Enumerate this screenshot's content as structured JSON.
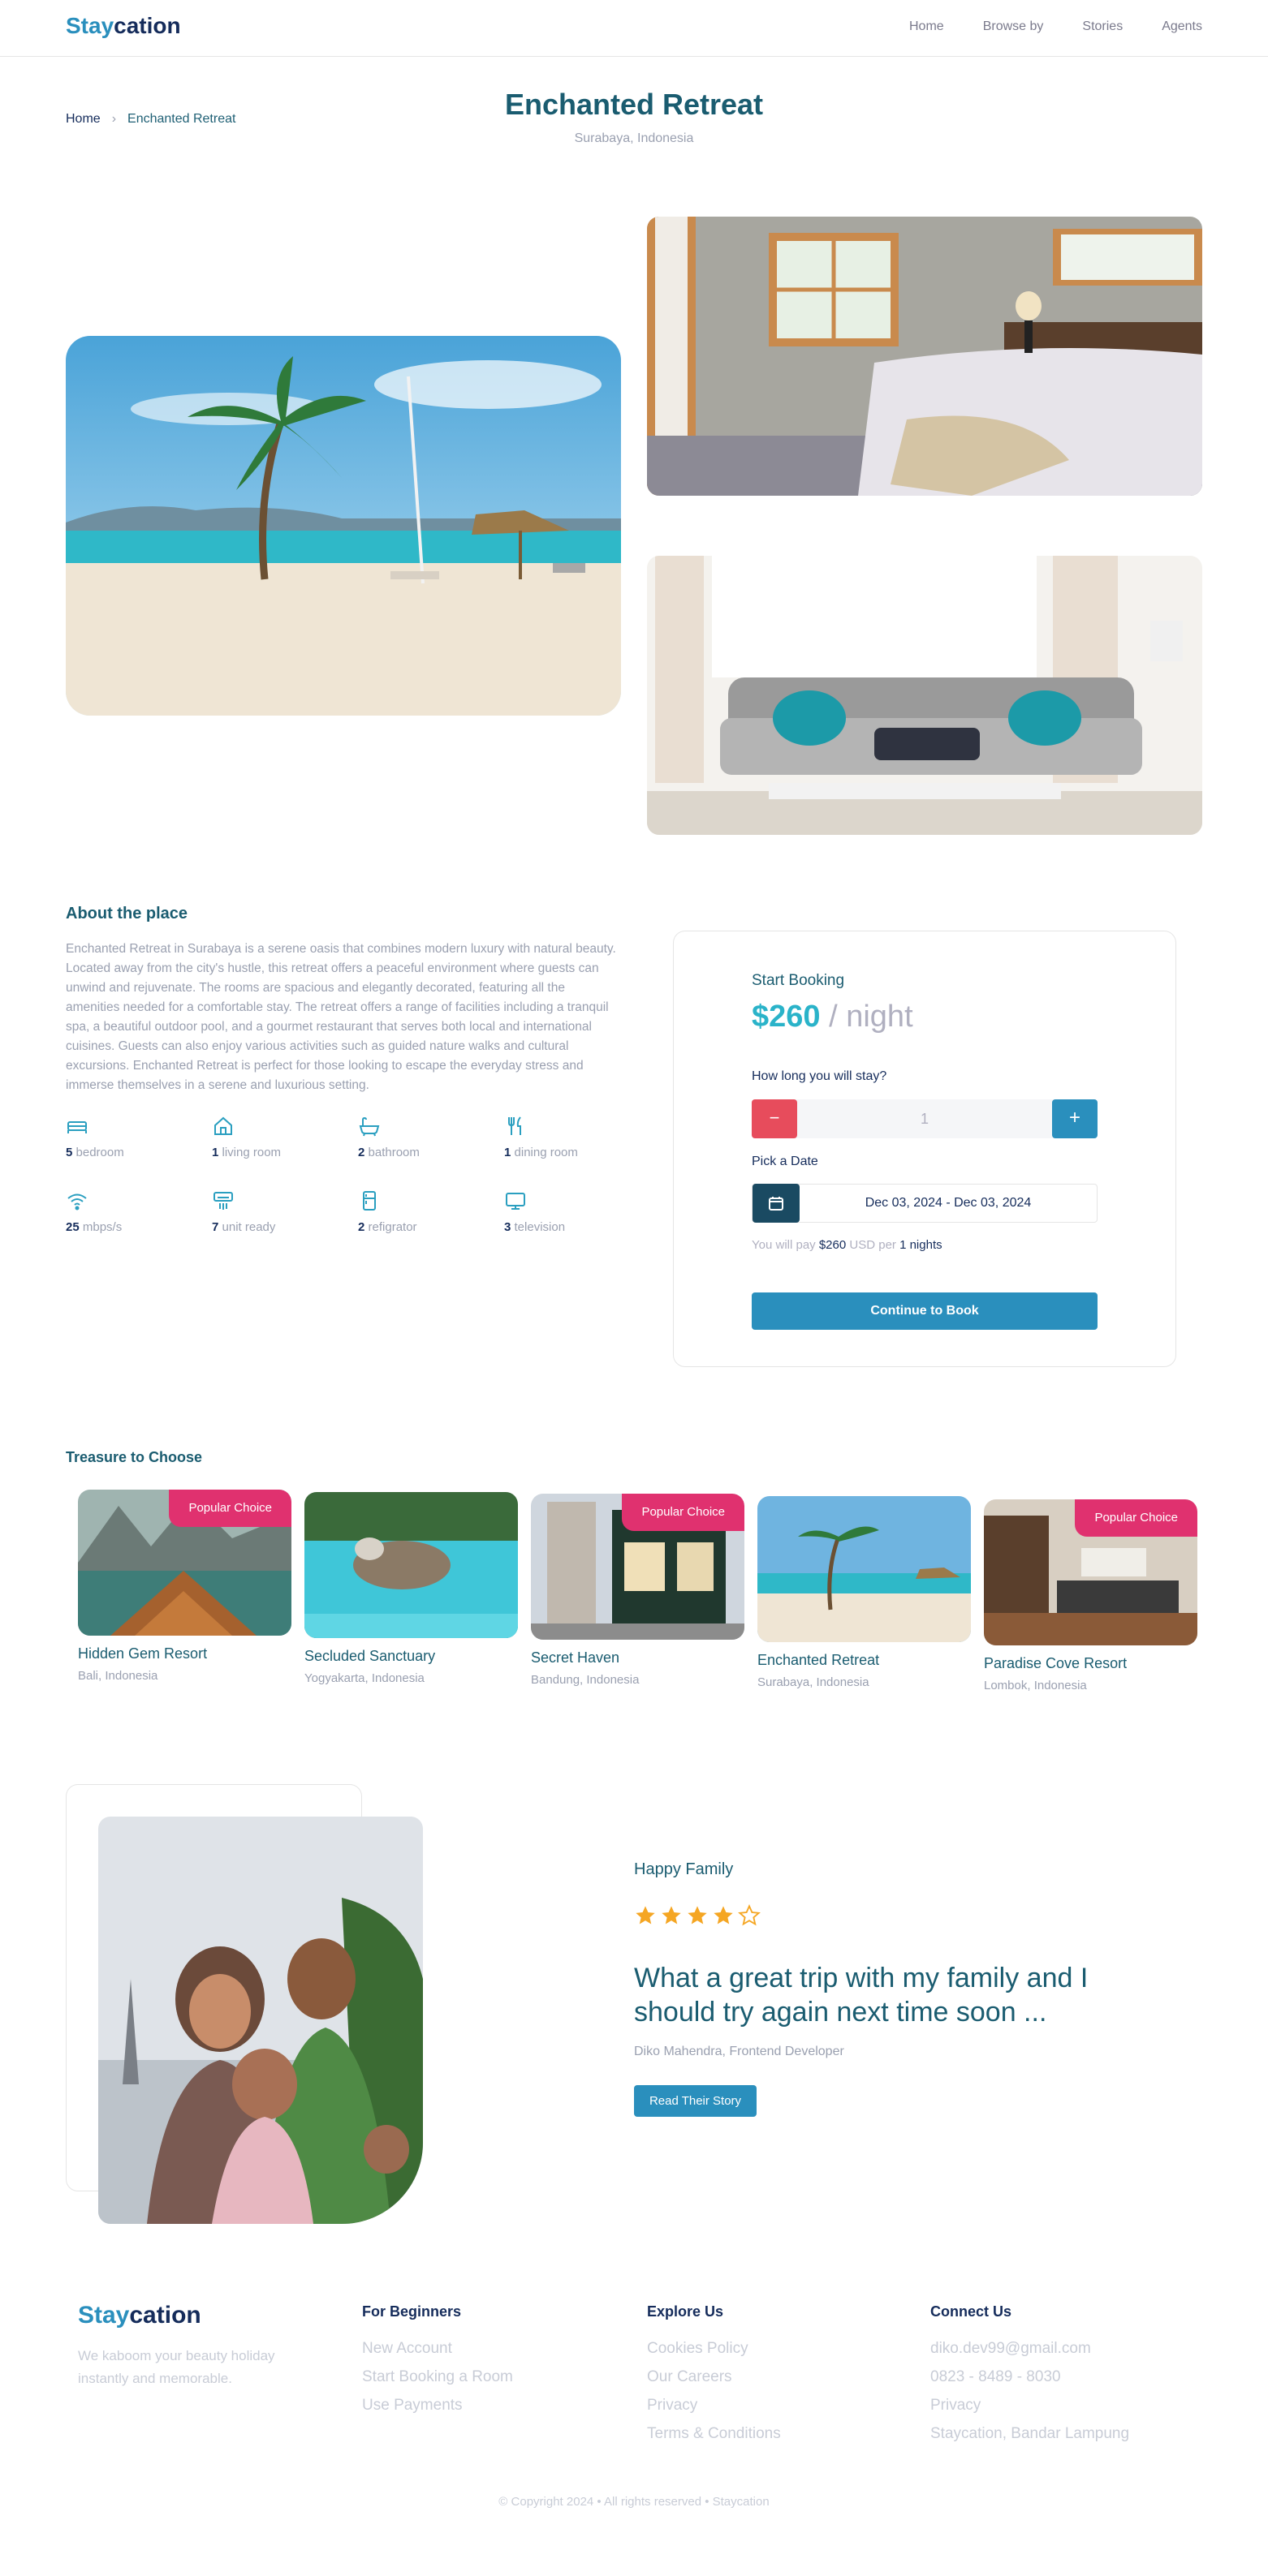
{
  "header": {
    "logo_accent": "Stay",
    "logo_rest": "cation",
    "nav": [
      "Home",
      "Browse by",
      "Stories",
      "Agents"
    ]
  },
  "breadcrumb": {
    "home": "Home",
    "separator": "›",
    "current": "Enchanted Retreat"
  },
  "title": "Enchanted Retreat",
  "subtitle": "Surabaya, Indonesia",
  "about": {
    "title": "About the place",
    "text": "Enchanted Retreat in Surabaya is a serene oasis that combines modern luxury with natural beauty. Located away from the city's hustle, this retreat offers a peaceful environment where guests can unwind and rejuvenate. The rooms are spacious and elegantly decorated, featuring all the amenities needed for a comfortable stay. The retreat offers a range of facilities including a tranquil spa, a beautiful outdoor pool, and a gourmet restaurant that serves both local and international cuisines. Guests can also enjoy various activities such as guided nature walks and cultural excursions. Enchanted Retreat is perfect for those looking to escape the everyday stress and immerse themselves in a serene and luxurious setting.",
    "features": [
      {
        "num": "5",
        "label": "bedroom",
        "icon": "bed-icon"
      },
      {
        "num": "1",
        "label": "living room",
        "icon": "house-icon"
      },
      {
        "num": "2",
        "label": "bathroom",
        "icon": "bathtub-icon"
      },
      {
        "num": "1",
        "label": "dining room",
        "icon": "cutlery-icon"
      },
      {
        "num": "25",
        "label": "mbps/s",
        "icon": "wifi-icon"
      },
      {
        "num": "7",
        "label": "unit ready",
        "icon": "ac-unit-icon"
      },
      {
        "num": "2",
        "label": "refigrator",
        "icon": "refrigerator-icon"
      },
      {
        "num": "3",
        "label": "television",
        "icon": "television-icon"
      }
    ]
  },
  "booking": {
    "title": "Start Booking",
    "price": "$260",
    "per": " / night",
    "stay_question": "How long you will stay?",
    "minus": "−",
    "nights_value": "1",
    "plus": "+",
    "date_label": "Pick a Date",
    "date_value": "Dec 03, 2024 - Dec 03, 2024",
    "pay_prefix": "You will pay ",
    "pay_amount": "$260",
    "pay_mid": " USD per ",
    "pay_nights": "1 nights",
    "button": "Continue to Book"
  },
  "treasure": {
    "title": "Treasure to Choose",
    "items": [
      {
        "name": "Hidden Gem Resort",
        "location": "Bali, Indonesia",
        "badge": "Popular Choice"
      },
      {
        "name": "Secluded Sanctuary",
        "location": "Yogyakarta, Indonesia",
        "badge": ""
      },
      {
        "name": "Secret Haven",
        "location": "Bandung, Indonesia",
        "badge": "Popular Choice"
      },
      {
        "name": "Enchanted Retreat",
        "location": "Surabaya, Indonesia",
        "badge": ""
      },
      {
        "name": "Paradise Cove Resort",
        "location": "Lombok, Indonesia",
        "badge": "Popular Choice"
      }
    ]
  },
  "testimonial": {
    "tag": "Happy Family",
    "rating": 4,
    "rating_max": 5,
    "quote": "What a great trip with my family and I should try again next time soon ...",
    "author": "Diko Mahendra, Frontend Developer",
    "button": "Read Their Story"
  },
  "footer": {
    "logo_accent": "Stay",
    "logo_rest": "cation",
    "tagline": "We kaboom your beauty holiday instantly and memorable.",
    "columns": [
      {
        "title": "For Beginners",
        "links": [
          "New Account",
          "Start Booking a Room",
          "Use Payments"
        ]
      },
      {
        "title": "Explore Us",
        "links": [
          "Cookies Policy",
          "Our Careers",
          "Privacy",
          "Terms & Conditions"
        ]
      },
      {
        "title": "Connect Us",
        "links": [
          "diko.dev99@gmail.com",
          "0823 - 8489 - 8030",
          "Privacy",
          "Staycation, Bandar Lampung"
        ]
      }
    ],
    "copyright": "© Copyright 2024 • All rights reserved • Staycation"
  },
  "colors": {
    "brand_dark": "#152c5b",
    "brand_teal": "#2a8fbd",
    "badge_pink": "#e0316f",
    "minus_red": "#e74c5c",
    "star": "#f5a623"
  }
}
